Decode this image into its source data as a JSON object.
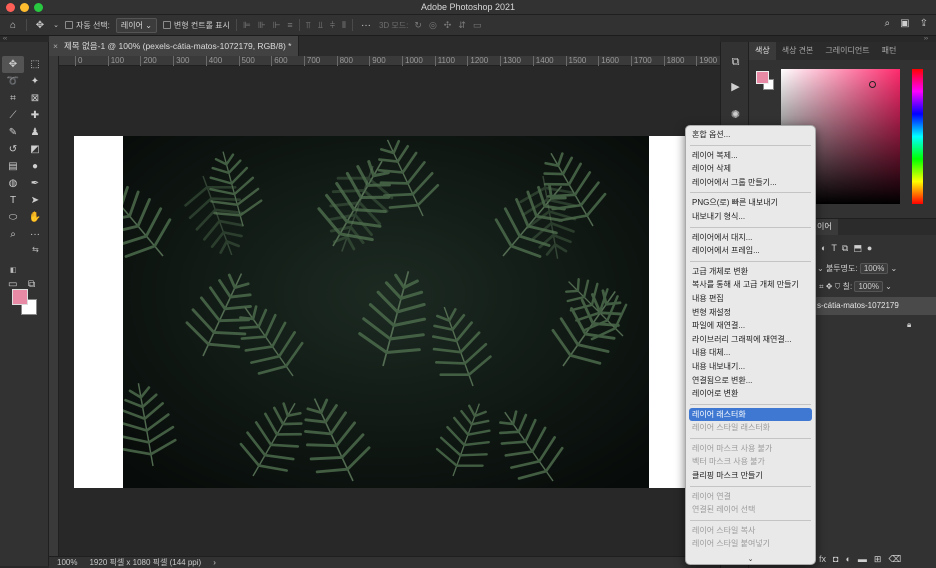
{
  "app": {
    "title": "Adobe Photoshop 2021"
  },
  "options": {
    "auto_select_label": "자동 선택:",
    "auto_select_value": "레이어",
    "transform_label": "변형 컨트롤 표시",
    "mode_3d": "3D 모드:"
  },
  "document": {
    "tab_title": "제목 없음-1 @ 100% (pexels-cátia-matos-1072179, RGB/8) *"
  },
  "ruler": {
    "ticks": [
      "0",
      "100",
      "200",
      "300",
      "400",
      "500",
      "600",
      "700",
      "800",
      "900",
      "1000",
      "1100",
      "1200",
      "1300",
      "1400",
      "1500",
      "1600",
      "1700",
      "1800",
      "1900"
    ]
  },
  "status": {
    "zoom": "100%",
    "doc_info": "1920 픽셀 x 1080 픽셀 (144 ppi)"
  },
  "color_panel": {
    "tabs": [
      "색상",
      "색상 견본",
      "그레이디언트",
      "패턴"
    ],
    "fg_color": "#e88aa6",
    "bg_color": "#ffffff"
  },
  "layers_panel": {
    "tab_partial": "이어",
    "opacity_label": "불투명도:",
    "opacity_value": "100%",
    "fill_label": "칠:",
    "fill_value": "100%",
    "layer_name": "s-cátia-matos-1072179"
  },
  "context_menu": {
    "items": [
      {
        "label": "혼합 옵션...",
        "disabled": false,
        "sep_after": true
      },
      {
        "label": "레이어 복제...",
        "disabled": false
      },
      {
        "label": "레이어 삭제",
        "disabled": false
      },
      {
        "label": "레이어에서 그룹 만들기...",
        "disabled": false,
        "sep_after": true
      },
      {
        "label": "PNG으(로) 빠른 내보내기",
        "disabled": false
      },
      {
        "label": "내보내기 형식...",
        "disabled": false,
        "sep_after": true
      },
      {
        "label": "레이어에서 대지...",
        "disabled": false
      },
      {
        "label": "레이어에서 프레임...",
        "disabled": false,
        "sep_after": true
      },
      {
        "label": "고급 개체로 변환",
        "disabled": false
      },
      {
        "label": "복사를 통해 새 고급 개체 만들기",
        "disabled": false
      },
      {
        "label": "내용 편집",
        "disabled": false
      },
      {
        "label": "변형 재설정",
        "disabled": false
      },
      {
        "label": "파일에 재연결...",
        "disabled": false
      },
      {
        "label": "라이브러리 그래픽에 재연결...",
        "disabled": false
      },
      {
        "label": "내용 대체...",
        "disabled": false
      },
      {
        "label": "내용 내보내기...",
        "disabled": false
      },
      {
        "label": "연결됨으로 변환...",
        "disabled": false
      },
      {
        "label": "레이어로 변환",
        "disabled": false,
        "sep_after": true
      },
      {
        "label": "레이어 래스터화",
        "disabled": false,
        "highlighted": true
      },
      {
        "label": "레이어 스타일 래스터화",
        "disabled": true,
        "sep_after": true
      },
      {
        "label": "레이어 마스크 사용 불가",
        "disabled": true
      },
      {
        "label": "벡터 마스크 사용 불가",
        "disabled": true
      },
      {
        "label": "클리핑 마스크 만들기",
        "disabled": false,
        "sep_after": true
      },
      {
        "label": "레이어 연결",
        "disabled": true
      },
      {
        "label": "연결된 레이어 선택",
        "disabled": true,
        "sep_after": true
      },
      {
        "label": "레이어 스타일 복사",
        "disabled": true
      },
      {
        "label": "레이어 스타일 붙여넣기",
        "disabled": true
      }
    ]
  },
  "colors": {
    "highlight": "#3f78d2",
    "panel": "#323232",
    "canvas": "#282828"
  }
}
